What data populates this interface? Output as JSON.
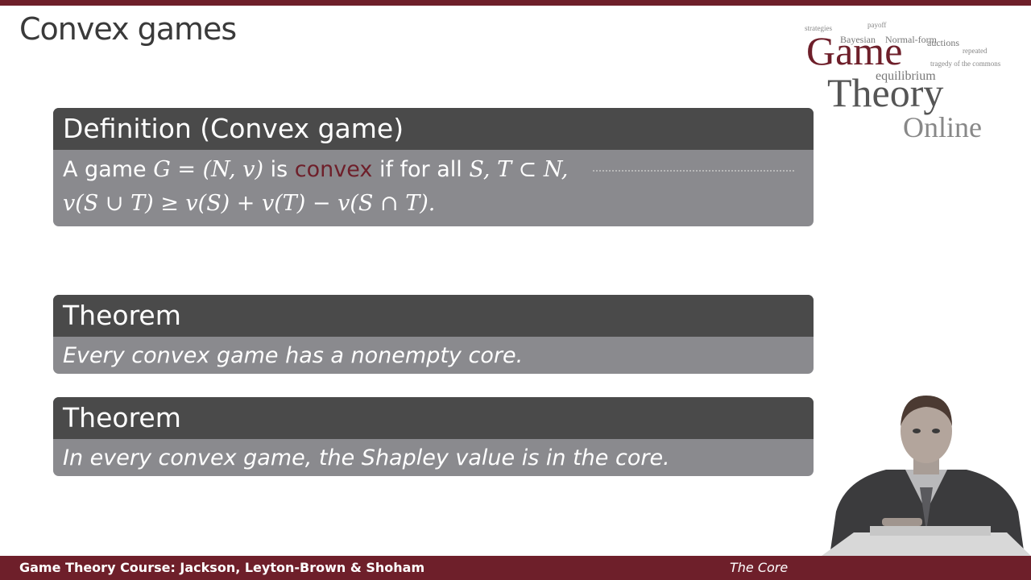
{
  "slide": {
    "title": "Convex games"
  },
  "logo": {
    "word1": "Game",
    "word2": "Theory",
    "word3": "Online",
    "cloud": [
      "payoff",
      "Bayesian",
      "Normal-form",
      "auctions",
      "tragedy of the commons",
      "equilibrium",
      "strategies",
      "repeated"
    ]
  },
  "definition": {
    "heading": "Definition (Convex game)",
    "line1_prefix": "A game",
    "line1_game": "G = (N, v)",
    "line1_is": "is",
    "line1_convex": "convex",
    "line1_forall": "if for all",
    "line1_sets": "S, T ⊂ N,",
    "line2": "v(S ∪ T) ≥ v(S) + v(T) − v(S ∩ T)."
  },
  "theorem1": {
    "heading": "Theorem",
    "text": "Every convex game has a nonempty core."
  },
  "theorem2": {
    "heading": "Theorem",
    "text": "In every convex game, the Shapley value is in the core."
  },
  "footer": {
    "left": "Game Theory Course: Jackson, Leyton-Brown & Shoham",
    "right": "The Core"
  },
  "colors": {
    "accent": "#6e1f2a",
    "block_header": "#4a4a4a",
    "block_body": "#8a8a8e"
  }
}
